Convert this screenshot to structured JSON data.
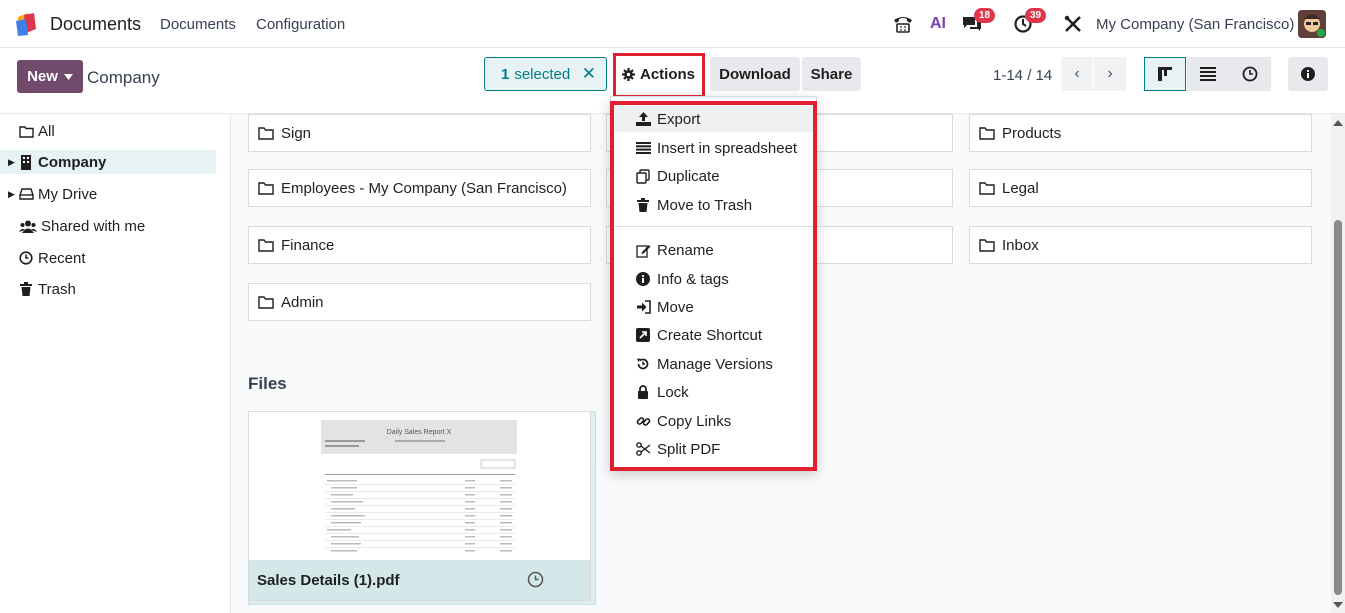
{
  "navbar": {
    "app_name": "Documents",
    "menus": [
      "Documents",
      "Configuration"
    ],
    "ai_label": "AI",
    "chat_badge": "18",
    "activity_badge": "39",
    "company": "My Company (San Francisco)"
  },
  "control_panel": {
    "new_label": "New",
    "title": "Company",
    "selected_count": "1",
    "selected_text": "selected",
    "actions_label": "Actions",
    "download_label": "Download",
    "share_label": "Share",
    "pager": "1-14 / 14"
  },
  "sidebar": {
    "items": [
      {
        "label": "All",
        "icon": "folder-open-icon"
      },
      {
        "label": "Company",
        "icon": "building-icon"
      },
      {
        "label": "My Drive",
        "icon": "drive-icon"
      },
      {
        "label": "Shared with me",
        "icon": "users-icon"
      },
      {
        "label": "Recent",
        "icon": "clock-icon"
      },
      {
        "label": "Trash",
        "icon": "trash-icon"
      }
    ]
  },
  "folders": {
    "col1": [
      "Sign",
      "Employees - My Company (San Francisco)",
      "Finance",
      "Admin"
    ],
    "col3": [
      "Products",
      "Legal",
      "Inbox"
    ]
  },
  "files": {
    "section_title": "Files",
    "items": [
      {
        "name": "Sales Details (1).pdf",
        "preview_title": "Daily Sales Report X"
      }
    ]
  },
  "actions_menu": {
    "group1": [
      "Export",
      "Insert in spreadsheet",
      "Duplicate",
      "Move to Trash"
    ],
    "group2": [
      "Rename",
      "Info & tags",
      "Move",
      "Create Shortcut",
      "Manage Versions",
      "Lock",
      "Copy Links",
      "Split PDF"
    ]
  },
  "colors": {
    "brand": "#71496a",
    "accent": "#017e84",
    "highlight_box": "#e0202e",
    "badge": "#e0364a"
  }
}
